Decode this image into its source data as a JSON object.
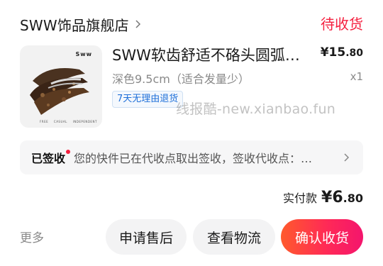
{
  "shop": {
    "name": "SWW饰品旗舰店",
    "status": "待收货"
  },
  "product": {
    "title": "SWW软齿舒适不硌头圆弧抓夹大号鲨鱼夹",
    "price_int": "¥15",
    "price_dec": ".80",
    "spec": "深色9.5cm（适合发量少）",
    "qty": "x1",
    "badge": "7天无理由退货",
    "thumb_brand": "Sww",
    "thumb_tags": "FREE CASUAL INDEPENDENT"
  },
  "watermark": "线报酷-new.xianbao.fun",
  "logistics": {
    "status": "已签收",
    "text": "您的快件已在代收点取出签收，签收代收点：…"
  },
  "total": {
    "label": "实付款",
    "amount_int": "¥6",
    "amount_dec": ".80"
  },
  "actions": {
    "more": "更多",
    "after_sale": "申请售后",
    "track": "查看物流",
    "confirm": "确认收货"
  },
  "colors": {
    "accent": "#f5203f",
    "badge_blue": "#1e6fd9"
  },
  "icons": [
    "chevron-right-icon"
  ]
}
